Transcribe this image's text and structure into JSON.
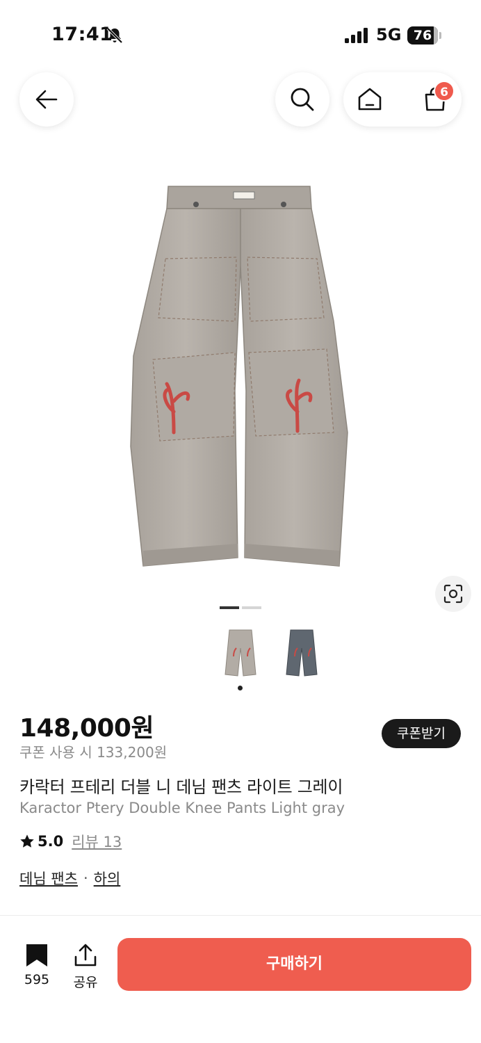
{
  "status_bar": {
    "time": "17:41",
    "network": "5G",
    "battery": "76"
  },
  "nav": {
    "cart_count": "6"
  },
  "gallery": {
    "product_colors": [
      "#b2aca5",
      "#5f6770"
    ]
  },
  "product": {
    "price": "148,000원",
    "coupon_price": "쿠폰 사용 시 133,200원",
    "coupon_button": "쿠폰받기",
    "name_ko": "카락터 프테리 더블 니 데님 팬츠 라이트 그레이",
    "name_en": "Karactor Ptery Double Knee Pants Light gray",
    "rating": "5.0",
    "review_label": "리뷰 13",
    "categories": [
      "데님 팬츠",
      "하의"
    ],
    "category_separator": "·"
  },
  "bottom_bar": {
    "bookmark_count": "595",
    "share_label": "공유",
    "buy_label": "구매하기"
  },
  "colors": {
    "accent": "#ef5d4f",
    "badge": "#ef5a4d",
    "dark": "#1a1a1a",
    "muted": "#8a8a8a"
  }
}
